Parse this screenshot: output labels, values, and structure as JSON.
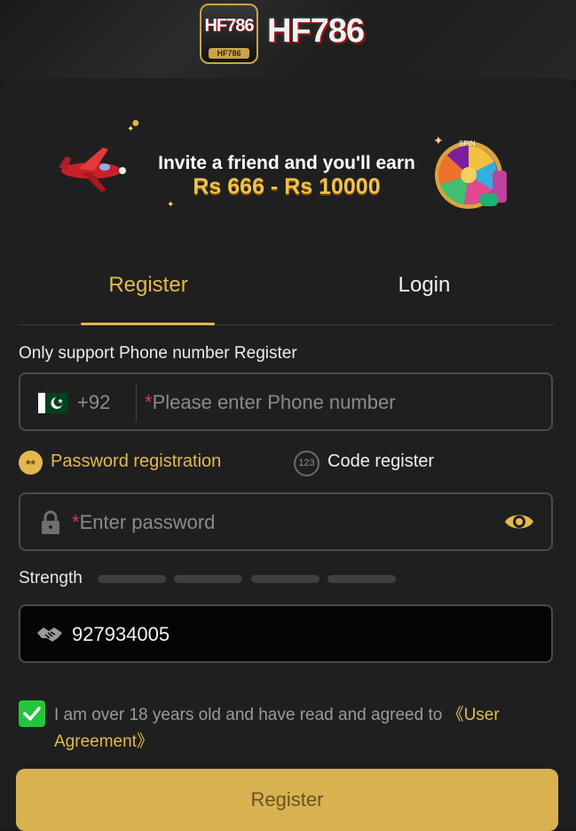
{
  "header": {
    "logo_badge_text": "HF786",
    "logo_badge_sub": "HF786",
    "logo_text": "HF786"
  },
  "banner": {
    "line1": "Invite a friend and you'll earn",
    "line2": "Rs 666 - Rs 10000",
    "wheel_label": "SPIN",
    "icons": [
      "airplane-icon",
      "spin-wheel-icon"
    ]
  },
  "tabs": {
    "register": "Register",
    "login": "Login"
  },
  "form": {
    "note": "Only support Phone number Register",
    "phone": {
      "country_code": "+92",
      "required_mark": "*",
      "placeholder": "Please enter Phone number",
      "flag": "pakistan-flag-icon"
    },
    "modes": {
      "password_label": "Password registration",
      "password_dot": "**",
      "code_label": "Code register",
      "code_dot": "123"
    },
    "password": {
      "required_mark": "*",
      "placeholder": "Enter password"
    },
    "strength_label": "Strength",
    "strength_level": 0,
    "invite_code": {
      "value": "927934005"
    },
    "agreement": {
      "checked": true,
      "text": "I am over 18 years old and have read and agreed to ",
      "link": "《User Agreement》"
    },
    "submit_label": "Register"
  },
  "colors": {
    "accent": "#e3b94f",
    "button": "#d8b151",
    "check": "#22c63a",
    "background": "#1f1f1f"
  }
}
